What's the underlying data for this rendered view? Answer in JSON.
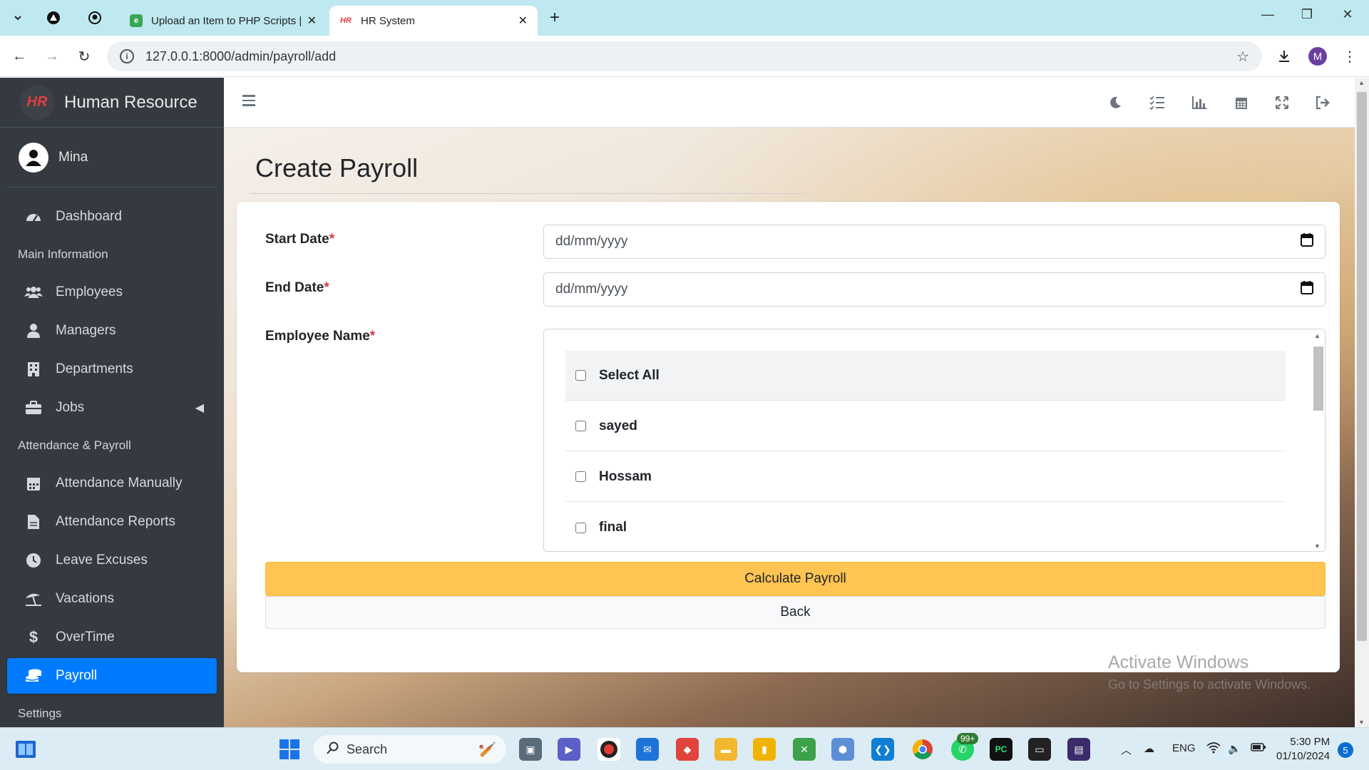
{
  "browser": {
    "tabs": [
      {
        "title": "Upload an Item to PHP Scripts |",
        "active": false
      },
      {
        "title": "HR System",
        "active": true
      }
    ],
    "url": "127.0.0.1:8000/admin/payroll/add",
    "profile_initial": "M"
  },
  "sidebar": {
    "brand_logo_text": "HR",
    "brand": "Human Resource",
    "user": "Mina",
    "items": [
      {
        "type": "item",
        "label": "Dashboard",
        "icon": "tachometer-icon"
      },
      {
        "type": "header",
        "label": "Main Information"
      },
      {
        "type": "item",
        "label": "Employees",
        "icon": "users-icon"
      },
      {
        "type": "item",
        "label": "Managers",
        "icon": "user-icon"
      },
      {
        "type": "item",
        "label": "Departments",
        "icon": "building-icon"
      },
      {
        "type": "item",
        "label": "Jobs",
        "icon": "briefcase-icon"
      },
      {
        "type": "header",
        "label": "Attendance & Payroll"
      },
      {
        "type": "item",
        "label": "Attendance Manually",
        "icon": "calendar-icon"
      },
      {
        "type": "item",
        "label": "Attendance Reports",
        "icon": "file-icon"
      },
      {
        "type": "item",
        "label": "Leave Excuses",
        "icon": "clock-icon"
      },
      {
        "type": "item",
        "label": "Vacations",
        "icon": "umbrella-beach-icon"
      },
      {
        "type": "item",
        "label": "OverTime",
        "icon": "dollar-icon"
      },
      {
        "type": "item",
        "label": "Payroll",
        "icon": "coins-icon",
        "active": true
      },
      {
        "type": "header",
        "label": "Settings"
      }
    ]
  },
  "page": {
    "title": "Create Payroll",
    "form": {
      "start_date_label": "Start Date",
      "end_date_label": "End Date",
      "employee_label": "Employee Name",
      "required_mark": "*",
      "date_placeholder": "dd/mm/yyyy",
      "employees": [
        "Select All",
        "sayed",
        "Hossam",
        "final"
      ],
      "calculate_button": "Calculate Payroll",
      "back_button": "Back"
    },
    "watermark_line1": "Activate Windows",
    "watermark_line2": "Go to Settings to activate Windows."
  },
  "taskbar": {
    "search_label": "Search",
    "whatsapp_badge": "99+",
    "language": "ENG",
    "time": "5:30 PM",
    "date": "01/10/2024",
    "notifications": "5"
  },
  "colors": {
    "sidebar_bg": "#343a40",
    "active_nav": "#007bff",
    "calculate_button": "#ffc451",
    "required": "#dc3545"
  }
}
